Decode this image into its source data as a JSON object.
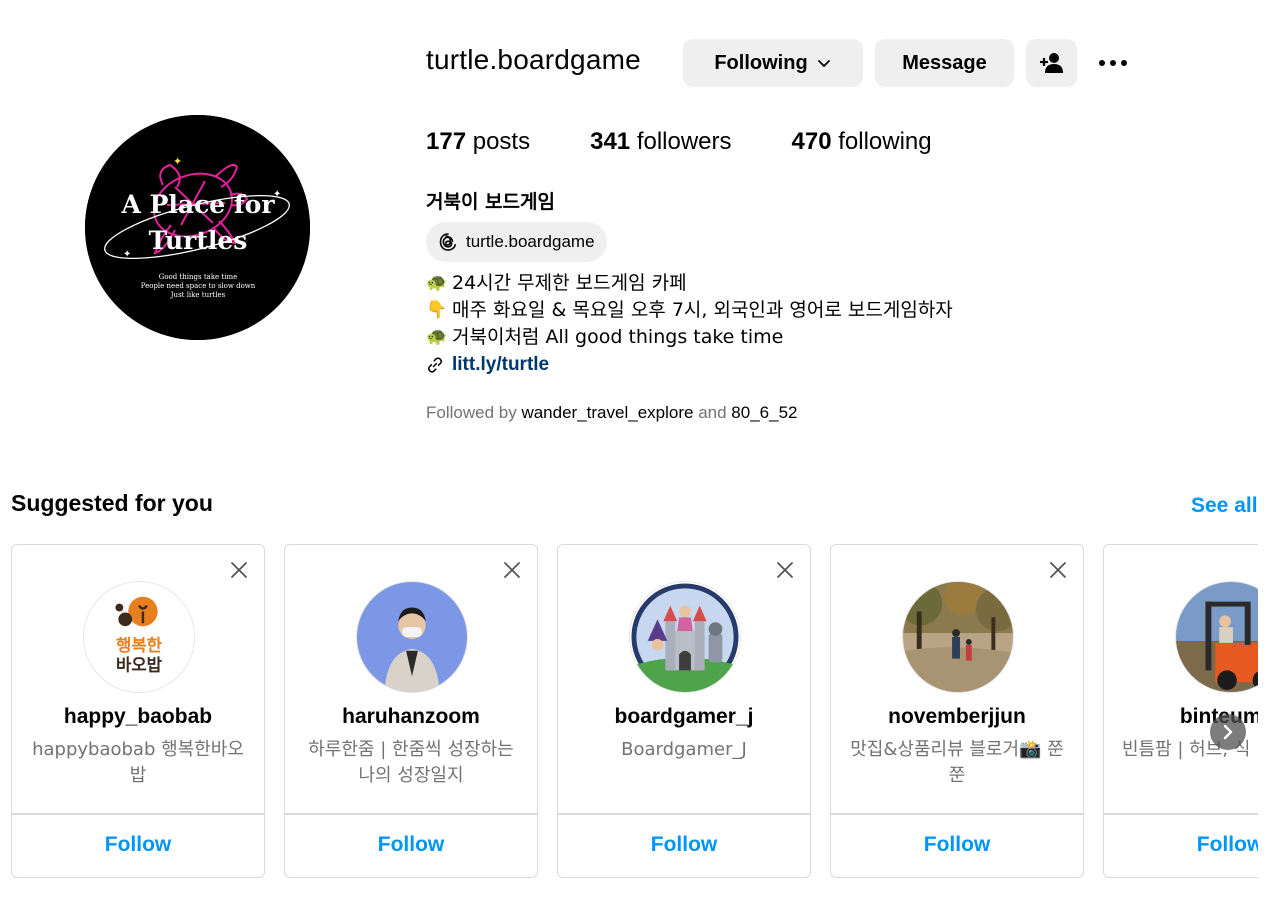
{
  "profile": {
    "username": "turtle.boardgame",
    "buttons": {
      "following": "Following",
      "message": "Message"
    },
    "avatar_text": {
      "line1": "A Place for",
      "line2": "Turtles",
      "tag1": "Good things take time",
      "tag2": "People need space to slow down",
      "tag3": "Just like turtles"
    },
    "stats": {
      "posts_count": "177",
      "posts_label": "posts",
      "followers_count": "341",
      "followers_label": "followers",
      "following_count": "470",
      "following_label": "following"
    },
    "full_name": "거북이 보드게임",
    "threads_handle": "turtle.boardgame",
    "bio": [
      {
        "emoji": "🐢",
        "text": "24시간 무제한 보드게임 카페"
      },
      {
        "emoji": "👇",
        "text": "매주 화요일 & 목요일 오후 7시, 외국인과 영어로 보드게임하자"
      },
      {
        "emoji": "🐢",
        "text": "거북이처럼 All good things take time"
      }
    ],
    "link": "litt.ly/turtle",
    "followed_by": {
      "prefix": "Followed by",
      "user1": "wander_travel_explore",
      "and": "and",
      "user2": "80_6_52"
    }
  },
  "suggested": {
    "title": "Suggested for you",
    "see_all": "See all",
    "follow_label": "Follow",
    "cards": [
      {
        "username": "happy_baobab",
        "subtitle": "happybaobab 행복한바오밥",
        "logo_line1": "행복한",
        "logo_line2": "바오밥"
      },
      {
        "username": "haruhanzoom",
        "subtitle": "하루한줌 | 한줌씩 성장하는 나의 성장일지"
      },
      {
        "username": "boardgamer_j",
        "subtitle": "Boardgamer_J"
      },
      {
        "username": "novemberjjun",
        "subtitle": "맛집&상품리뷰 블로거📸 쭌쭌"
      },
      {
        "username": "binteum_f",
        "subtitle": "빈틈팜 | 허브, 식"
      }
    ]
  },
  "colors": {
    "accent": "#0095f6",
    "link": "#00376b",
    "button_bg": "#efefef",
    "muted": "#737373",
    "avatar_pink": "#e3219a"
  }
}
